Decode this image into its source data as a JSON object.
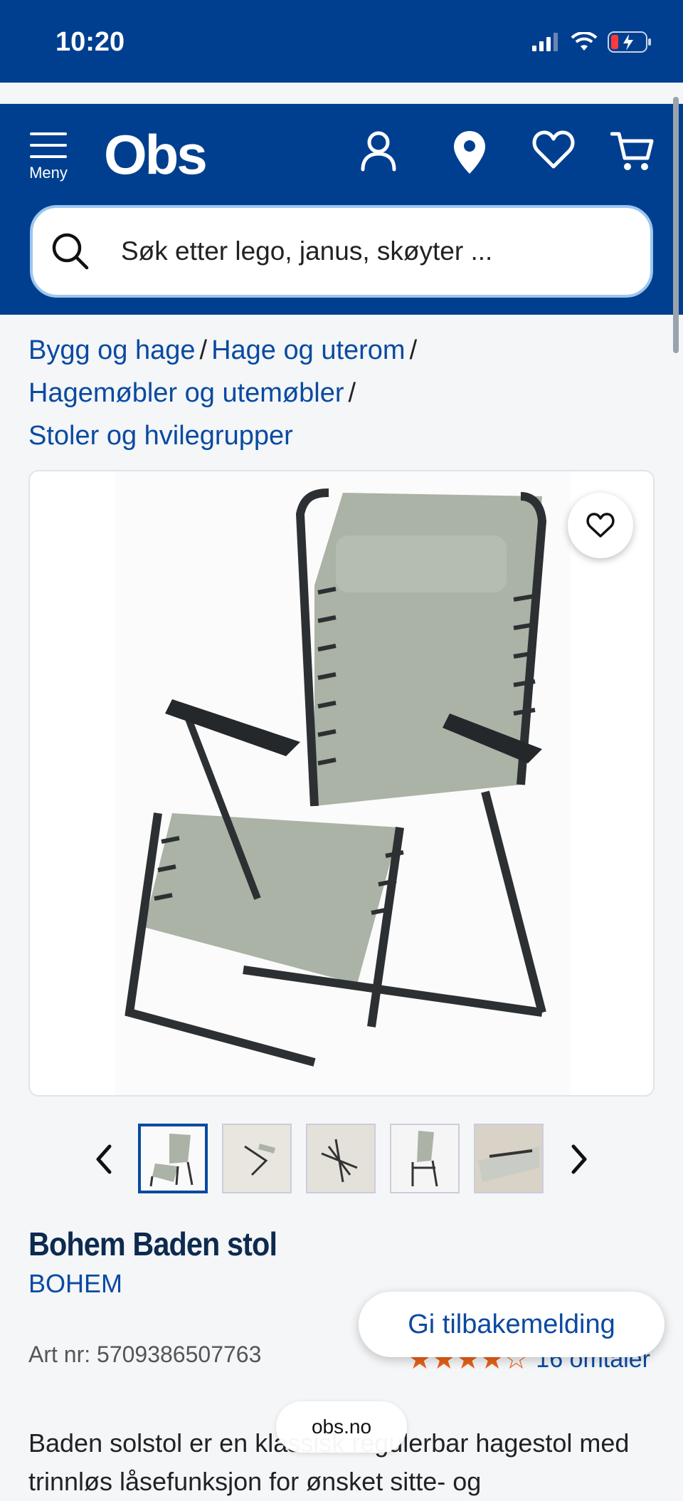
{
  "status_bar": {
    "time": "10:20"
  },
  "header": {
    "menu_label": "Meny",
    "logo": "Obs",
    "search_placeholder": "Søk etter lego, janus, skøyter ..."
  },
  "breadcrumb": {
    "items": [
      "Bygg og hage",
      "Hage og uterom",
      "Hagemøbler og utemøbler",
      "Stoler og hvilegrupper"
    ],
    "separator": "/"
  },
  "product": {
    "title": "Bohem Baden stol",
    "brand": "BOHEM",
    "art_nr": "Art nr: 5709386507763",
    "rating": 4.5,
    "reviews": "16 omtaler",
    "description": "Baden solstol er en klassisk regulerbar hagestol med trinnløs låsefunksjon for ønsket sitte- og"
  },
  "gallery": {
    "thumbnail_count": 5,
    "active_index": 0
  },
  "feedback_button": "Gi tilbakemelding",
  "browser": {
    "url": "obs.no"
  },
  "colors": {
    "brand_blue": "#003f8f",
    "link_blue": "#0a4aa0",
    "star_orange": "#e8621a"
  }
}
